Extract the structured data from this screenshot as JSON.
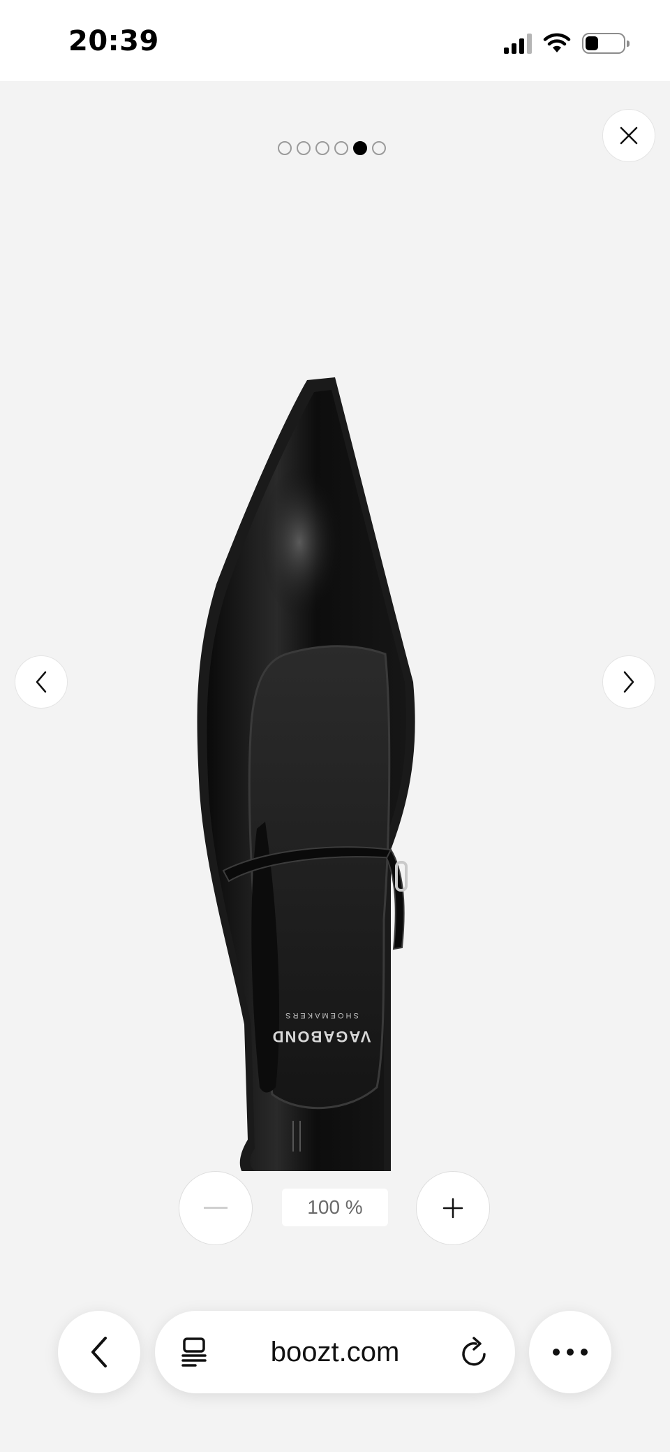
{
  "status_bar": {
    "time": "20:39",
    "battery_level": 0.35
  },
  "carousel": {
    "total_images": 6,
    "current_index": 4
  },
  "viewer": {
    "close_icon": "close-icon",
    "prev_icon": "chevron-left-icon",
    "next_icon": "chevron-right-icon",
    "product_image_brand_text": "VAGABOND SHOEMAKERS"
  },
  "zoom": {
    "level": "100 %",
    "minus_icon": "minus-icon",
    "plus_icon": "plus-icon"
  },
  "browser": {
    "url": "boozt.com",
    "back_icon": "chevron-left-icon",
    "tabs_icon": "tabs-icon",
    "reload_icon": "reload-icon",
    "more_icon": "more-icon"
  }
}
